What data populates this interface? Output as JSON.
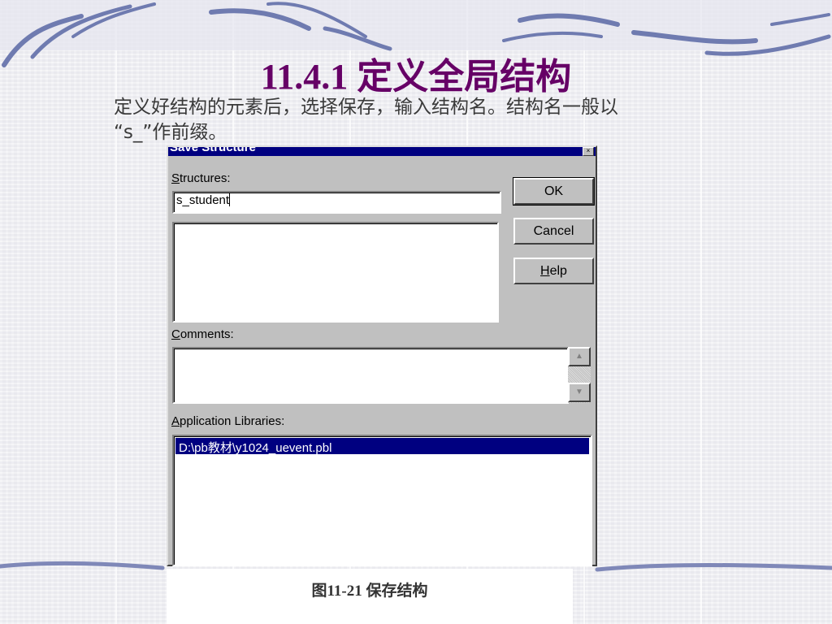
{
  "slide": {
    "title": "11.4.1 定义全局结构",
    "intro_line1": "定义好结构的元素后，选择保存，输入结构名。结构名一般以",
    "intro_line2": "“s_”作前缀。",
    "caption": "图11-21 保存结构"
  },
  "dialog": {
    "title": "Save Structure",
    "close_glyph": "×",
    "structures_label_accel": "S",
    "structures_label_rest": "tructures:",
    "structure_name_value": "s_student",
    "comments_label_accel": "C",
    "comments_label_rest": "omments:",
    "libraries_label_accel": "A",
    "libraries_label_rest": "pplication Libraries:",
    "libraries": [
      "D:\\pb教材\\y1024_uevent.pbl"
    ],
    "ok_label": "OK",
    "cancel_label": "Cancel",
    "help_label_accel": "H",
    "help_label_rest": "elp",
    "scroll_up_glyph": "▲",
    "scroll_down_glyph": "▼"
  },
  "colors": {
    "title": "#660066",
    "titlebar": "#000080",
    "selection": "#000080",
    "dialog_face": "#c0c0c0"
  }
}
